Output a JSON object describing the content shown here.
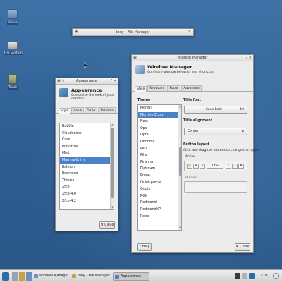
{
  "desktop": {
    "icons": [
      {
        "label": "Home"
      },
      {
        "label": "File System"
      },
      {
        "label": "Trash"
      }
    ]
  },
  "file_manager_mini": {
    "title": "tony - File Manager"
  },
  "appearance": {
    "window_title": "Appearance",
    "heading": "Appearance",
    "subheading": "Customize the look of your desktop",
    "tabs": [
      "Style",
      "Icons",
      "Fonts",
      "Settings"
    ],
    "active_tab": "Style",
    "styles": [
      "Bubble",
      "Cloudcooks",
      "Crux",
      "Industrial",
      "Mint",
      "Murrine-Entry",
      "Raleigh",
      "Redmond",
      "Thinice",
      "Xfce",
      "Xfce-4.0",
      "Xfce-4.2"
    ],
    "selected_style": "Murrine-Entry",
    "close_label": "Close"
  },
  "window_manager": {
    "window_title": "Window Manager",
    "heading": "Window Manager",
    "subheading": "Configure window behavior and shortcuts",
    "tabs": [
      "Style",
      "Keyboard",
      "Focus",
      "Advanced"
    ],
    "active_tab": "Style",
    "theme_header": "Theme",
    "themes": [
      "Moheli",
      "Murrine-Entry",
      "Nest",
      "Ops",
      "Opta",
      "Ondoros",
      "Perl",
      "Pills",
      "Piranha",
      "Platinum",
      "Prune",
      "Quiet-purple",
      "Quoto",
      "RGK",
      "Redmond",
      "RedmondXP",
      "Retro"
    ],
    "selected_theme": "Murrine-Entry",
    "title_font_label": "Title font",
    "title_font_name": "Sans Bold",
    "title_font_size": "10",
    "title_alignment_label": "Title alignment",
    "title_alignment_value": "Center",
    "button_layout_label": "Button layout",
    "button_layout_hint": "Click and drag the buttons to change the layout",
    "active_label": "Active",
    "title_button_label": "Title",
    "hidden_label": "Hidden",
    "help_label": "Help",
    "close_label": "Close"
  },
  "taskbar": {
    "tasks": [
      "Window Manager",
      "tony - File Manager",
      "Appearance"
    ],
    "active_task": "Appearance",
    "clock": "12:03"
  }
}
